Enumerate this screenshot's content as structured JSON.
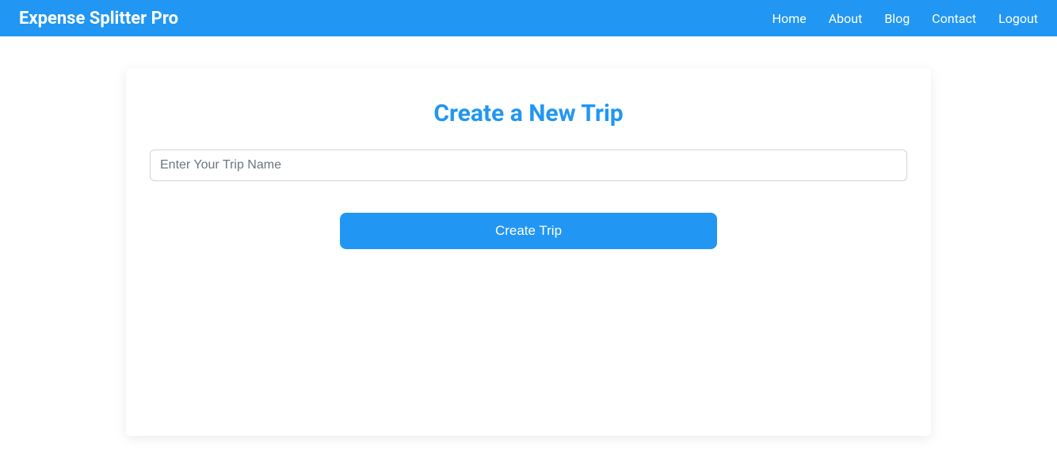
{
  "navbar": {
    "brand": "Expense Splitter Pro",
    "links": {
      "home": "Home",
      "about": "About",
      "blog": "Blog",
      "contact": "Contact",
      "logout": "Logout"
    }
  },
  "card": {
    "title": "Create a New Trip",
    "input_placeholder": "Enter Your Trip Name",
    "input_value": "",
    "button_label": "Create Trip"
  }
}
